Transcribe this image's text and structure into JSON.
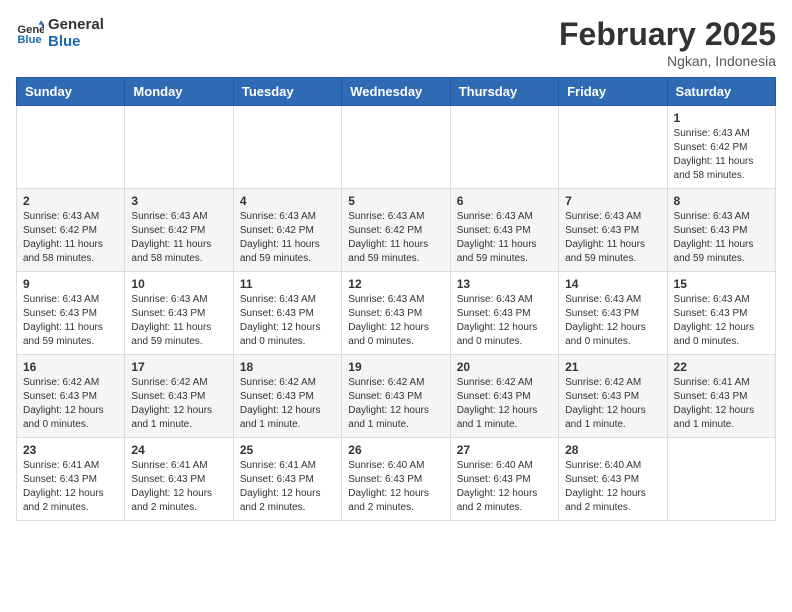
{
  "header": {
    "logo_line1": "General",
    "logo_line2": "Blue",
    "month": "February 2025",
    "location": "Ngkan, Indonesia"
  },
  "days_of_week": [
    "Sunday",
    "Monday",
    "Tuesday",
    "Wednesday",
    "Thursday",
    "Friday",
    "Saturday"
  ],
  "weeks": [
    [
      {
        "day": "",
        "info": ""
      },
      {
        "day": "",
        "info": ""
      },
      {
        "day": "",
        "info": ""
      },
      {
        "day": "",
        "info": ""
      },
      {
        "day": "",
        "info": ""
      },
      {
        "day": "",
        "info": ""
      },
      {
        "day": "1",
        "info": "Sunrise: 6:43 AM\nSunset: 6:42 PM\nDaylight: 11 hours\nand 58 minutes."
      }
    ],
    [
      {
        "day": "2",
        "info": "Sunrise: 6:43 AM\nSunset: 6:42 PM\nDaylight: 11 hours\nand 58 minutes."
      },
      {
        "day": "3",
        "info": "Sunrise: 6:43 AM\nSunset: 6:42 PM\nDaylight: 11 hours\nand 58 minutes."
      },
      {
        "day": "4",
        "info": "Sunrise: 6:43 AM\nSunset: 6:42 PM\nDaylight: 11 hours\nand 59 minutes."
      },
      {
        "day": "5",
        "info": "Sunrise: 6:43 AM\nSunset: 6:42 PM\nDaylight: 11 hours\nand 59 minutes."
      },
      {
        "day": "6",
        "info": "Sunrise: 6:43 AM\nSunset: 6:43 PM\nDaylight: 11 hours\nand 59 minutes."
      },
      {
        "day": "7",
        "info": "Sunrise: 6:43 AM\nSunset: 6:43 PM\nDaylight: 11 hours\nand 59 minutes."
      },
      {
        "day": "8",
        "info": "Sunrise: 6:43 AM\nSunset: 6:43 PM\nDaylight: 11 hours\nand 59 minutes."
      }
    ],
    [
      {
        "day": "9",
        "info": "Sunrise: 6:43 AM\nSunset: 6:43 PM\nDaylight: 11 hours\nand 59 minutes."
      },
      {
        "day": "10",
        "info": "Sunrise: 6:43 AM\nSunset: 6:43 PM\nDaylight: 11 hours\nand 59 minutes."
      },
      {
        "day": "11",
        "info": "Sunrise: 6:43 AM\nSunset: 6:43 PM\nDaylight: 12 hours\nand 0 minutes."
      },
      {
        "day": "12",
        "info": "Sunrise: 6:43 AM\nSunset: 6:43 PM\nDaylight: 12 hours\nand 0 minutes."
      },
      {
        "day": "13",
        "info": "Sunrise: 6:43 AM\nSunset: 6:43 PM\nDaylight: 12 hours\nand 0 minutes."
      },
      {
        "day": "14",
        "info": "Sunrise: 6:43 AM\nSunset: 6:43 PM\nDaylight: 12 hours\nand 0 minutes."
      },
      {
        "day": "15",
        "info": "Sunrise: 6:43 AM\nSunset: 6:43 PM\nDaylight: 12 hours\nand 0 minutes."
      }
    ],
    [
      {
        "day": "16",
        "info": "Sunrise: 6:42 AM\nSunset: 6:43 PM\nDaylight: 12 hours\nand 0 minutes."
      },
      {
        "day": "17",
        "info": "Sunrise: 6:42 AM\nSunset: 6:43 PM\nDaylight: 12 hours\nand 1 minute."
      },
      {
        "day": "18",
        "info": "Sunrise: 6:42 AM\nSunset: 6:43 PM\nDaylight: 12 hours\nand 1 minute."
      },
      {
        "day": "19",
        "info": "Sunrise: 6:42 AM\nSunset: 6:43 PM\nDaylight: 12 hours\nand 1 minute."
      },
      {
        "day": "20",
        "info": "Sunrise: 6:42 AM\nSunset: 6:43 PM\nDaylight: 12 hours\nand 1 minute."
      },
      {
        "day": "21",
        "info": "Sunrise: 6:42 AM\nSunset: 6:43 PM\nDaylight: 12 hours\nand 1 minute."
      },
      {
        "day": "22",
        "info": "Sunrise: 6:41 AM\nSunset: 6:43 PM\nDaylight: 12 hours\nand 1 minute."
      }
    ],
    [
      {
        "day": "23",
        "info": "Sunrise: 6:41 AM\nSunset: 6:43 PM\nDaylight: 12 hours\nand 2 minutes."
      },
      {
        "day": "24",
        "info": "Sunrise: 6:41 AM\nSunset: 6:43 PM\nDaylight: 12 hours\nand 2 minutes."
      },
      {
        "day": "25",
        "info": "Sunrise: 6:41 AM\nSunset: 6:43 PM\nDaylight: 12 hours\nand 2 minutes."
      },
      {
        "day": "26",
        "info": "Sunrise: 6:40 AM\nSunset: 6:43 PM\nDaylight: 12 hours\nand 2 minutes."
      },
      {
        "day": "27",
        "info": "Sunrise: 6:40 AM\nSunset: 6:43 PM\nDaylight: 12 hours\nand 2 minutes."
      },
      {
        "day": "28",
        "info": "Sunrise: 6:40 AM\nSunset: 6:43 PM\nDaylight: 12 hours\nand 2 minutes."
      },
      {
        "day": "",
        "info": ""
      }
    ]
  ]
}
